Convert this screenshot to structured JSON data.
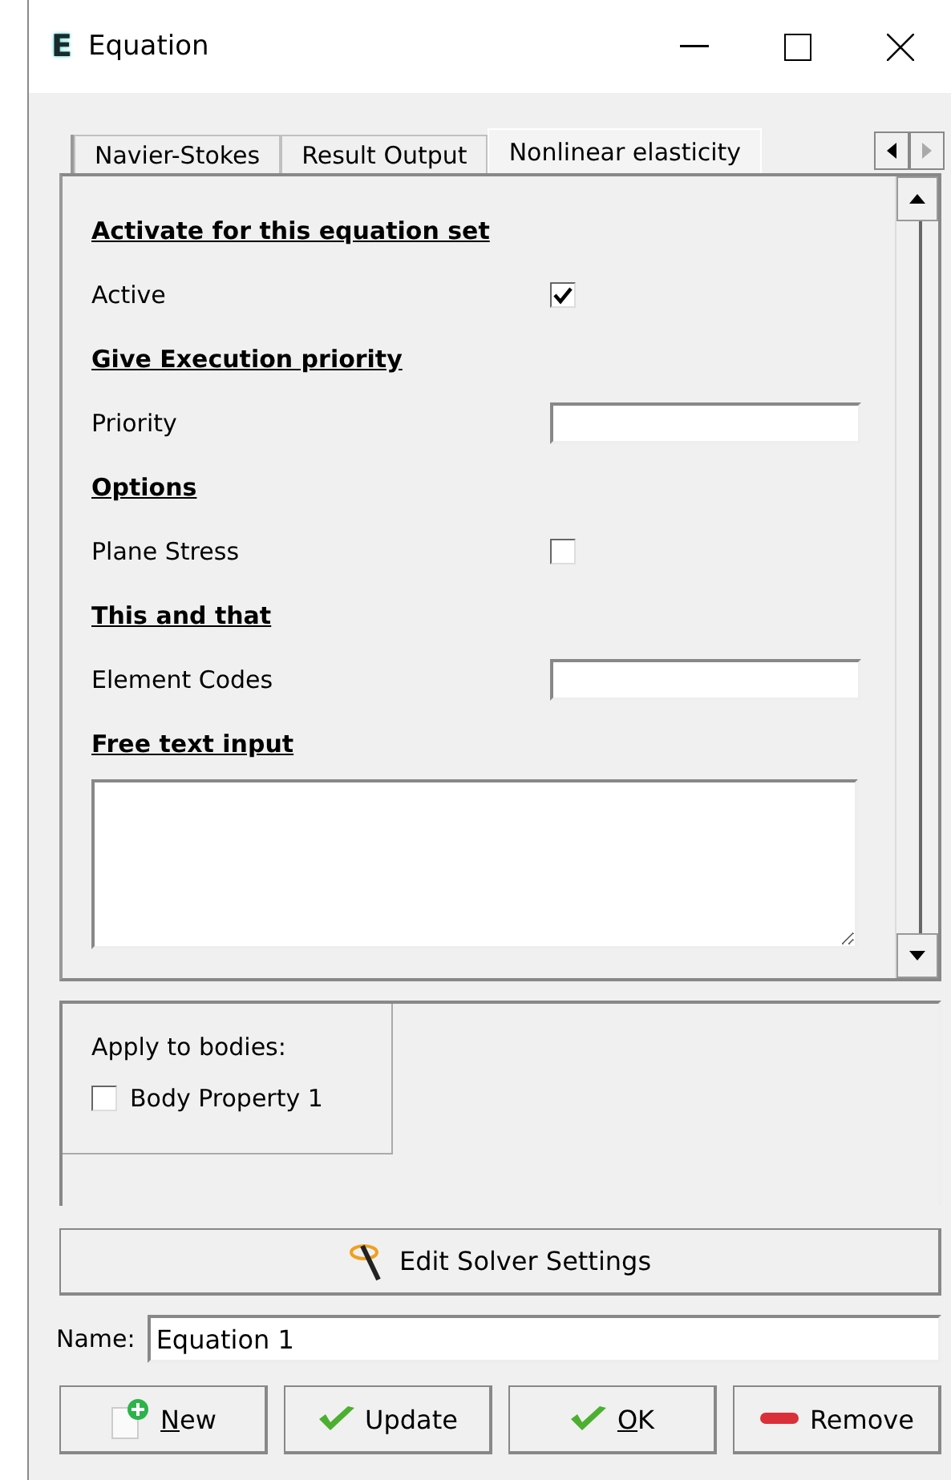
{
  "window": {
    "title": "Equation",
    "icon_letter": "E"
  },
  "tabs": [
    {
      "label": "Navier-Stokes",
      "selected": false
    },
    {
      "label": "Result Output",
      "selected": false
    },
    {
      "label": "Nonlinear elasticity",
      "selected": true
    }
  ],
  "form": [
    {
      "kind": "heading",
      "label": "Activate for this equation set"
    },
    {
      "kind": "checkbox",
      "label": "Active",
      "checked": true
    },
    {
      "kind": "heading",
      "label": "Give Execution priority"
    },
    {
      "kind": "text",
      "label": "Priority"
    },
    {
      "kind": "heading",
      "label": "Options"
    },
    {
      "kind": "checkbox",
      "label": "Plane Stress",
      "checked": false
    },
    {
      "kind": "heading",
      "label": "This and that"
    },
    {
      "kind": "text",
      "label": "Element Codes"
    },
    {
      "kind": "heading",
      "label": "Free text input"
    },
    {
      "kind": "textarea"
    }
  ],
  "bodies": {
    "title": "Apply to bodies:",
    "items": [
      {
        "label": "Body Property 1",
        "checked": false
      }
    ]
  },
  "edit_solver_button": "Edit Solver Settings",
  "name_field": {
    "label": "Name:",
    "value": "Equation 1"
  },
  "buttons": [
    {
      "kind": "new",
      "mnemonic": "N",
      "label_rest": "ew"
    },
    {
      "kind": "update",
      "label": "Update"
    },
    {
      "kind": "ok",
      "mnemonic": "O",
      "label_rest": "K"
    },
    {
      "kind": "remove",
      "label": "Remove"
    }
  ]
}
